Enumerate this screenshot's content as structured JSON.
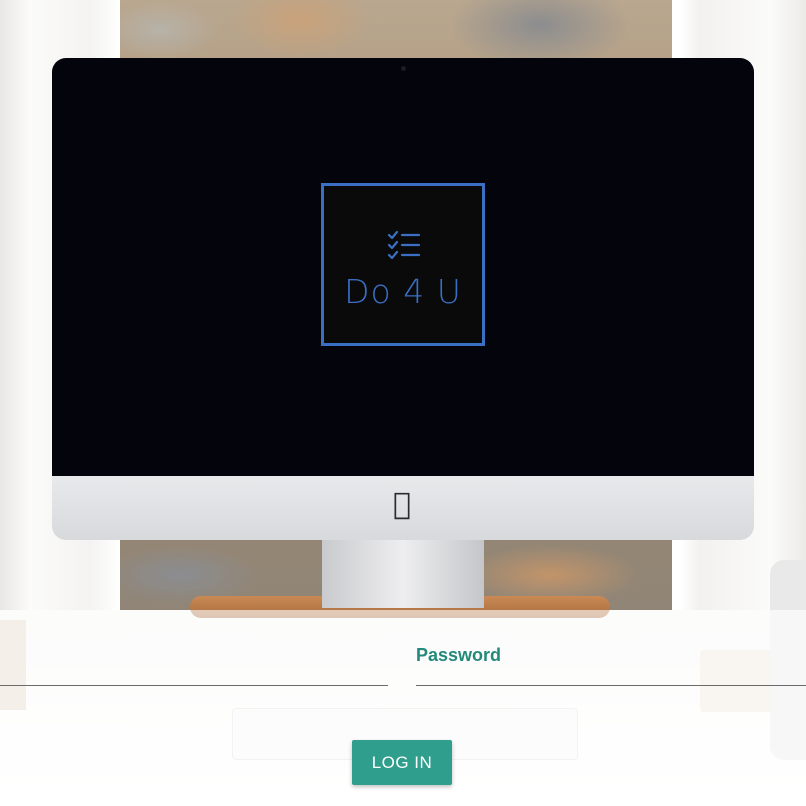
{
  "app": {
    "logo_text": "Do 4 U",
    "logo_icon": "checklist-icon",
    "brand_color": "#3a6fc4"
  },
  "login_form": {
    "email_value": "",
    "password_label": "Password",
    "password_value": "",
    "login_label": "LOG IN",
    "accent_color": "#23897a",
    "button_color": "#2f9e8c"
  },
  "background": {
    "device_logo_icon": "apple-icon"
  }
}
